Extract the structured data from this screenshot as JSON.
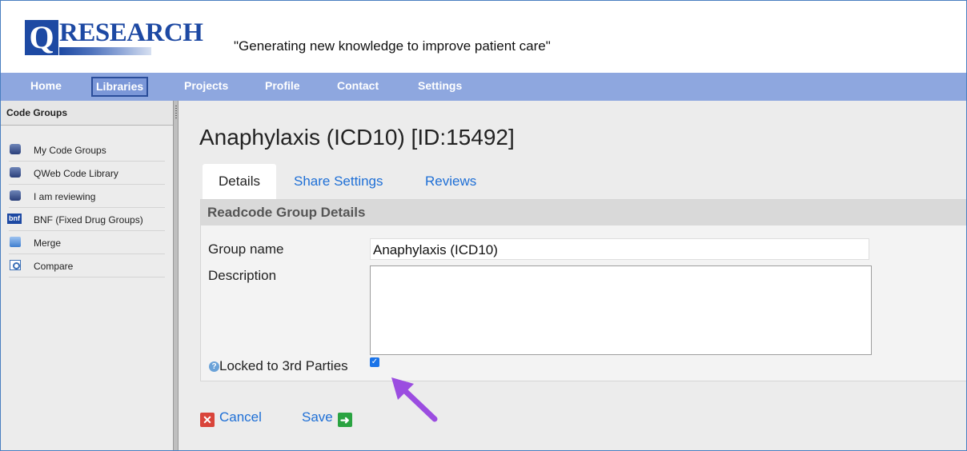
{
  "brand": {
    "logo_letter": "Q",
    "logo_text": "RESEARCH",
    "tagline": "\"Generating new knowledge to improve patient care\""
  },
  "nav": [
    "Home",
    "Libraries",
    "Projects",
    "Profile",
    "Contact",
    "Settings"
  ],
  "nav_active": "Libraries",
  "sidebar": {
    "title": "Code Groups",
    "items": [
      {
        "label": "My Code Groups",
        "icon": "database-icon"
      },
      {
        "label": "QWeb Code Library",
        "icon": "database-icon"
      },
      {
        "label": "I am reviewing",
        "icon": "database-icon"
      },
      {
        "label": "BNF (Fixed Drug Groups)",
        "icon": "bnf-icon",
        "icon_text": "bnf"
      },
      {
        "label": "Merge",
        "icon": "merge-icon"
      },
      {
        "label": "Compare",
        "icon": "compare-icon"
      }
    ]
  },
  "main": {
    "title": "Anaphylaxis (ICD10) [ID:15492]",
    "tabs": [
      "Details",
      "Share Settings",
      "Reviews"
    ],
    "active_tab": "Details",
    "panel_title": "Readcode Group Details",
    "fields": {
      "group_name_label": "Group name",
      "group_name_value": "Anaphylaxis (ICD10)",
      "description_label": "Description",
      "description_value": "",
      "locked_label": "Locked to 3rd Parties",
      "locked_checked": true
    },
    "actions": {
      "cancel": "Cancel",
      "save": "Save"
    }
  },
  "colors": {
    "nav_bg": "#8ea7df",
    "brand_blue": "#1d49a3",
    "link": "#1e6fd6",
    "annotation_arrow": "#9b4de0"
  }
}
